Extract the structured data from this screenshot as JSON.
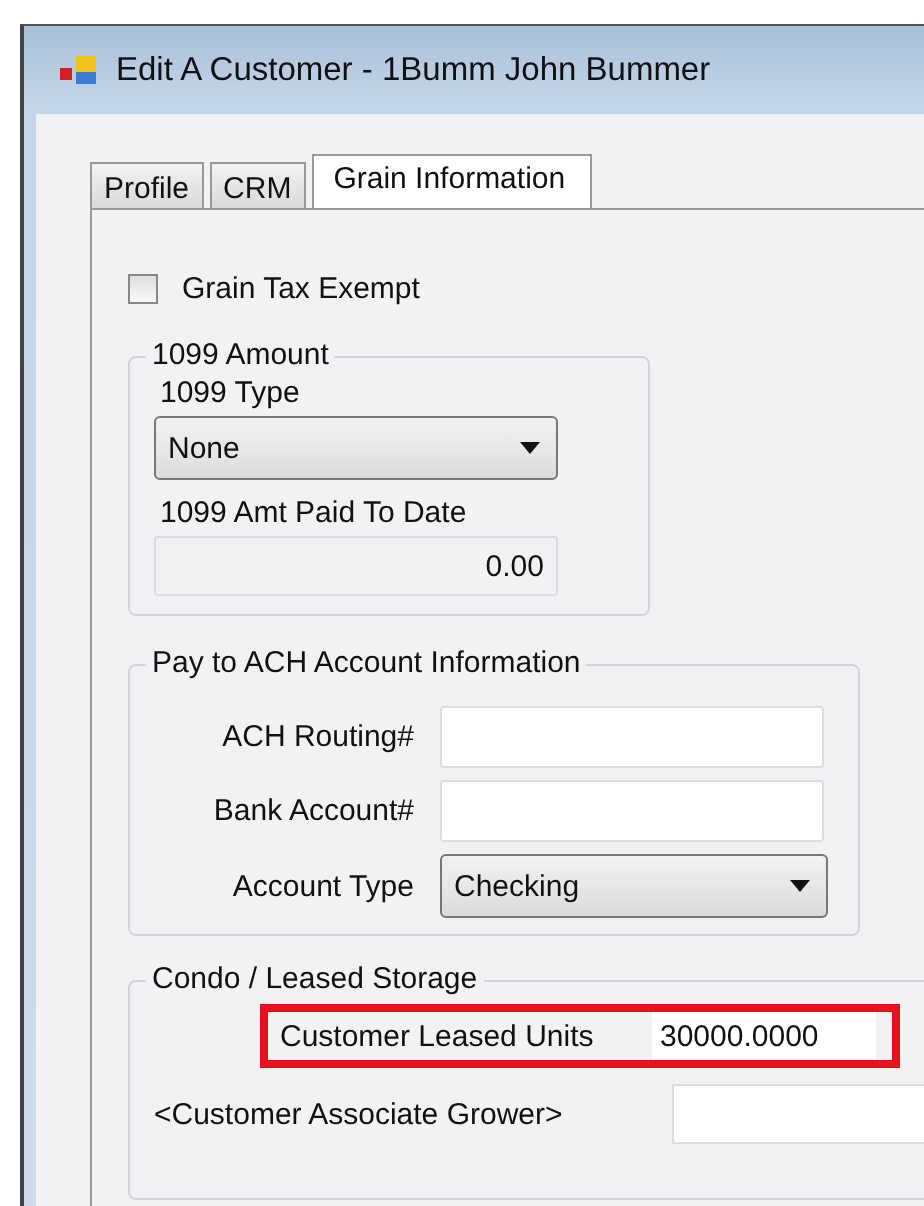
{
  "window": {
    "title": "Edit A Customer - 1Bumm John Bummer"
  },
  "tabs": [
    {
      "label": "Profile",
      "selected": false
    },
    {
      "label": "CRM",
      "selected": false
    },
    {
      "label": "Grain Information",
      "selected": true
    }
  ],
  "grain_tax_exempt": {
    "label": "Grain Tax Exempt",
    "checked": false
  },
  "amount_1099": {
    "legend": "1099 Amount",
    "type_label": "1099 Type",
    "type_value": "None",
    "paid_label": "1099 Amt Paid To Date",
    "paid_value": "0.00"
  },
  "ach": {
    "legend": "Pay to ACH Account Information",
    "fields": [
      {
        "kind": "text",
        "label": "ACH Routing#"
      },
      {
        "kind": "text",
        "label": "Bank Account#"
      },
      {
        "kind": "dropdown",
        "label": "Account Type",
        "value": "Checking"
      }
    ]
  },
  "condo": {
    "legend": "Condo / Leased Storage",
    "fields": [
      {
        "label": "Customer Leased Units",
        "value": "30000.0000",
        "highlighted": true
      },
      {
        "label": "<Customer Associate Grower>",
        "highlighted": false
      }
    ]
  }
}
